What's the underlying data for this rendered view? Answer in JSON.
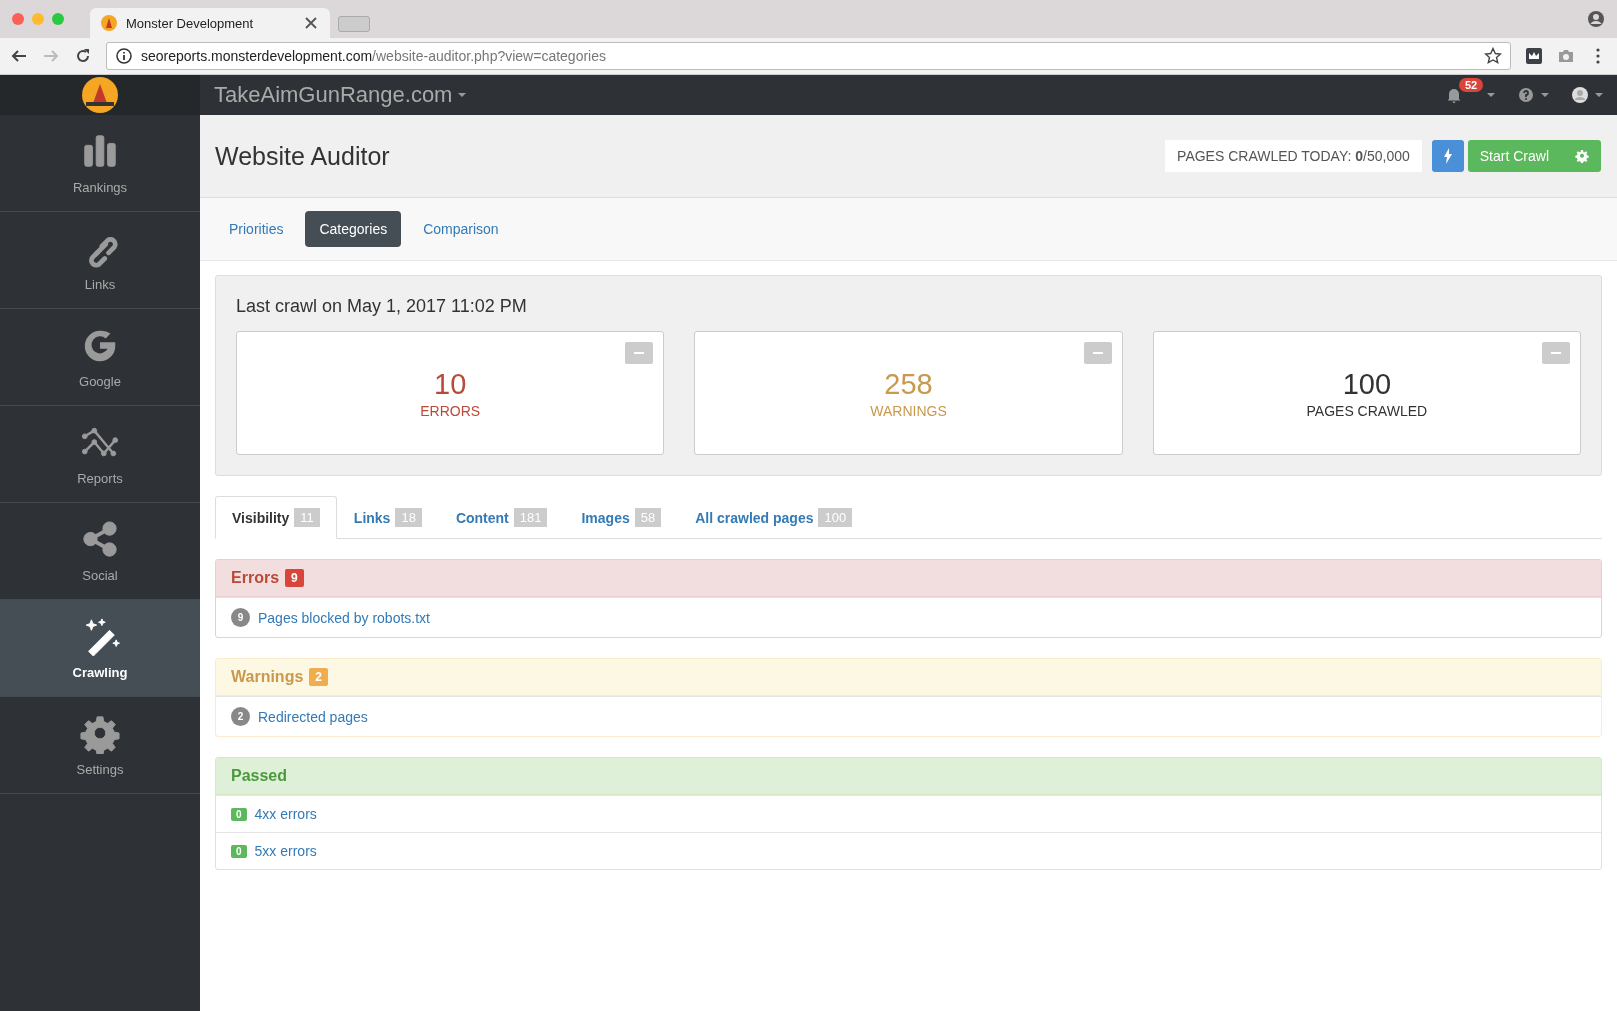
{
  "browser": {
    "tab_title": "Monster Development",
    "url_host": "seoreports.monsterdevelopment.com",
    "url_path": "/website-auditor.php?view=categories"
  },
  "navbar": {
    "site": "TakeAimGunRange.com",
    "notification_count": "52"
  },
  "sidebar": {
    "items": [
      {
        "label": "Rankings",
        "selected": false
      },
      {
        "label": "Links",
        "selected": false
      },
      {
        "label": "Google",
        "selected": false
      },
      {
        "label": "Reports",
        "selected": false
      },
      {
        "label": "Social",
        "selected": false
      },
      {
        "label": "Crawling",
        "selected": true
      },
      {
        "label": "Settings",
        "selected": false
      }
    ]
  },
  "page": {
    "title": "Website Auditor",
    "crawl_status": "PAGES CRAWLED TODAY: **0**/50,000",
    "start_button": "Start Crawl"
  },
  "view_tabs": [
    {
      "label": "Priorities",
      "selected": false
    },
    {
      "label": "Categories",
      "selected": true
    },
    {
      "label": "Comparison",
      "selected": false
    }
  ],
  "summary": {
    "heading": "Last crawl on May 1, 2017 11:02 PM",
    "cards": [
      {
        "kind": "error",
        "value": "10",
        "label": "ERRORS"
      },
      {
        "kind": "warning",
        "value": "258",
        "label": "WARNINGS"
      },
      {
        "kind": "neutral",
        "value": "100",
        "label": "PAGES CRAWLED"
      }
    ]
  },
  "category_tabs": [
    {
      "label": "Visibility",
      "count": "11",
      "selected": true
    },
    {
      "label": "Links",
      "count": "18",
      "selected": false
    },
    {
      "label": "Content",
      "count": "181",
      "selected": false
    },
    {
      "label": "Images",
      "count": "58",
      "selected": false
    },
    {
      "label": "All crawled pages",
      "count": "100",
      "selected": false
    }
  ],
  "panels": [
    {
      "kind": "error",
      "title": "Errors",
      "count": "9",
      "items": [
        {
          "count": "9",
          "label": "Pages blocked by robots.txt"
        }
      ]
    },
    {
      "kind": "warning",
      "title": "Warnings",
      "count": "2",
      "items": [
        {
          "count": "2",
          "label": "Redirected pages"
        }
      ]
    },
    {
      "kind": "success",
      "title": "Passed",
      "items": [
        {
          "count": "0",
          "label": "4xx errors"
        },
        {
          "count": "0",
          "label": "5xx errors"
        }
      ]
    }
  ]
}
